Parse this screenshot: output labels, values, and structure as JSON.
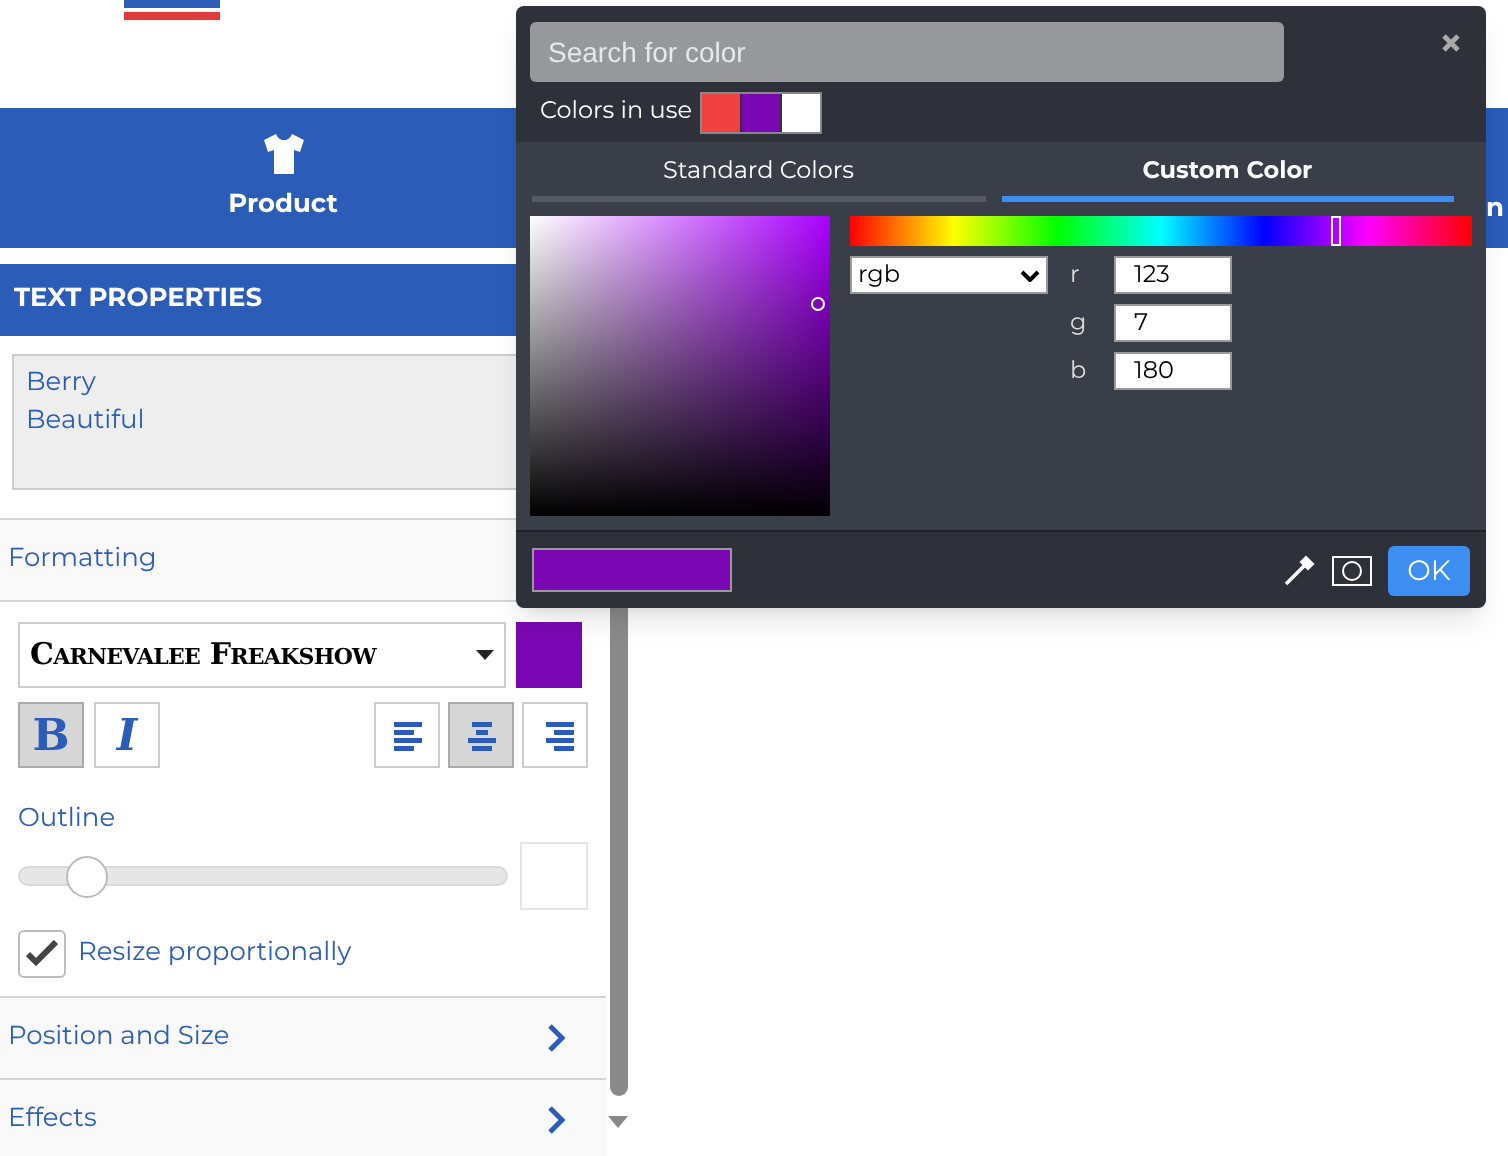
{
  "nav_tabs": [
    {
      "label": "Product"
    },
    {
      "label": "n"
    }
  ],
  "panel": {
    "title": "TEXT PROPERTIES",
    "text_value": "Berry\nBeautiful",
    "formatting": {
      "title": "Formatting",
      "font": "Carnevalee Freakshow",
      "color": "#7b07b4",
      "styles": [
        {
          "kind": "bold",
          "label": "B",
          "selected": true
        },
        {
          "kind": "italic",
          "label": "I",
          "selected": false
        }
      ],
      "align": [
        {
          "kind": "left",
          "selected": false
        },
        {
          "kind": "center",
          "selected": true
        },
        {
          "kind": "right",
          "selected": false
        }
      ],
      "outline_label": "Outline",
      "outline": {
        "level": 0.1
      },
      "resize": {
        "label": "Resize proportionally",
        "checked": true
      }
    },
    "sections": [
      {
        "title": "Position and Size"
      },
      {
        "title": "Effects"
      }
    ]
  },
  "color_picker": {
    "search_placeholder": "Search for color",
    "colors_in_use_label": "Colors in use",
    "colors_in_use": [
      {
        "color": "#f04040"
      },
      {
        "color": "#7b07b4"
      },
      {
        "color": "#ffffff"
      }
    ],
    "tabs": [
      {
        "label": "Standard Colors",
        "selected": false
      },
      {
        "label": "Custom Color",
        "selected": true
      }
    ],
    "hue": {
      "level": 0.78
    },
    "mode": "rgb",
    "channels": [
      {
        "label": "r",
        "value": "123"
      },
      {
        "label": "g",
        "value": "7"
      },
      {
        "label": "b",
        "value": "180"
      }
    ],
    "ok": "OK"
  }
}
